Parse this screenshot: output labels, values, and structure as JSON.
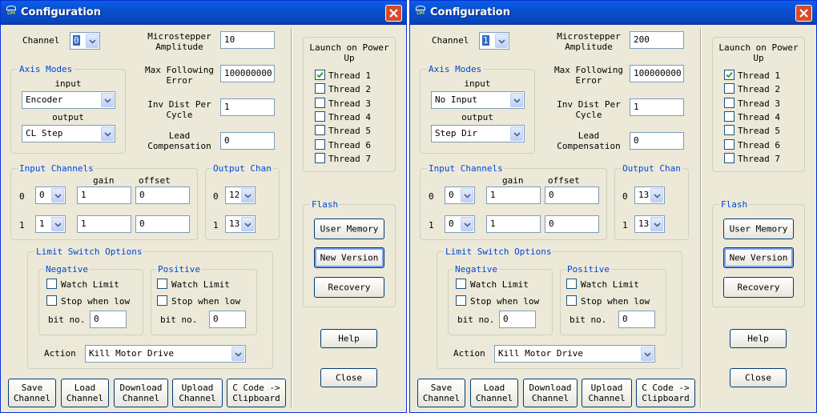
{
  "windows": [
    {
      "title": "Configuration",
      "channel_label": "Channel",
      "channel_value": "0",
      "microstepper_label": "Microstepper Amplitude",
      "microstepper_value": "10",
      "max_following_label": "Max Following Error",
      "max_following_value": "100000000",
      "inv_dist_label": "Inv Dist Per Cycle",
      "inv_dist_value": "1",
      "lead_comp_label": "Lead Compensation",
      "lead_comp_value": "0",
      "axis_modes": {
        "title": "Axis Modes",
        "input_label": "input",
        "input_value": "Encoder",
        "output_label": "output",
        "output_value": "CL Step"
      },
      "input_channels": {
        "title": "Input Channels",
        "gain_label": "gain",
        "offset_label": "offset",
        "rows": [
          {
            "label": "0",
            "channel": "0",
            "gain": "1",
            "offset": "0"
          },
          {
            "label": "1",
            "channel": "1",
            "gain": "1",
            "offset": "0"
          }
        ]
      },
      "output_chan": {
        "title": "Output Chan",
        "rows": [
          {
            "label": "0",
            "value": "12"
          },
          {
            "label": "1",
            "value": "13"
          }
        ]
      },
      "limit_switch": {
        "title": "Limit Switch Options",
        "negative": {
          "title": "Negative",
          "watch_label": "Watch Limit",
          "stop_label": "Stop when low",
          "bit_label": "bit no.",
          "bit_value": "0"
        },
        "positive": {
          "title": "Positive",
          "watch_label": "Watch Limit",
          "stop_label": "Stop when low",
          "bit_label": "bit no.",
          "bit_value": "0"
        },
        "action_label": "Action",
        "action_value": "Kill Motor Drive"
      },
      "launch": {
        "title": "Launch on Power Up",
        "threads": [
          "Thread 1",
          "Thread 2",
          "Thread 3",
          "Thread 4",
          "Thread 5",
          "Thread 6",
          "Thread 7"
        ]
      },
      "flash": {
        "title": "Flash",
        "user_memory": "User Memory",
        "new_version": "New Version",
        "recovery": "Recovery"
      },
      "help": "Help",
      "close": "Close",
      "bottom_buttons": [
        "Save\nChannel",
        "Load\nChannel",
        "Download\nChannel",
        "Upload\nChannel",
        "C Code ->\nClipboard"
      ]
    },
    {
      "title": "Configuration",
      "channel_label": "Channel",
      "channel_value": "1",
      "microstepper_label": "Microstepper Amplitude",
      "microstepper_value": "200",
      "max_following_label": "Max Following Error",
      "max_following_value": "100000000",
      "inv_dist_label": "Inv Dist Per Cycle",
      "inv_dist_value": "1",
      "lead_comp_label": "Lead Compensation",
      "lead_comp_value": "0",
      "axis_modes": {
        "title": "Axis Modes",
        "input_label": "input",
        "input_value": "No Input",
        "output_label": "output",
        "output_value": "Step Dir"
      },
      "input_channels": {
        "title": "Input Channels",
        "gain_label": "gain",
        "offset_label": "offset",
        "rows": [
          {
            "label": "0",
            "channel": "0",
            "gain": "1",
            "offset": "0"
          },
          {
            "label": "1",
            "channel": "0",
            "gain": "1",
            "offset": "0"
          }
        ]
      },
      "output_chan": {
        "title": "Output Chan",
        "rows": [
          {
            "label": "0",
            "value": "13"
          },
          {
            "label": "1",
            "value": "13"
          }
        ]
      },
      "limit_switch": {
        "title": "Limit Switch Options",
        "negative": {
          "title": "Negative",
          "watch_label": "Watch Limit",
          "stop_label": "Stop when low",
          "bit_label": "bit no.",
          "bit_value": "0"
        },
        "positive": {
          "title": "Positive",
          "watch_label": "Watch Limit",
          "stop_label": "Stop when low",
          "bit_label": "bit no.",
          "bit_value": "0"
        },
        "action_label": "Action",
        "action_value": "Kill Motor Drive"
      },
      "launch": {
        "title": "Launch on Power Up",
        "threads": [
          "Thread 1",
          "Thread 2",
          "Thread 3",
          "Thread 4",
          "Thread 5",
          "Thread 6",
          "Thread 7"
        ]
      },
      "flash": {
        "title": "Flash",
        "user_memory": "User Memory",
        "new_version": "New Version",
        "recovery": "Recovery"
      },
      "help": "Help",
      "close": "Close",
      "bottom_buttons": [
        "Save\nChannel",
        "Load\nChannel",
        "Download\nChannel",
        "Upload\nChannel",
        "C Code ->\nClipboard"
      ]
    }
  ]
}
